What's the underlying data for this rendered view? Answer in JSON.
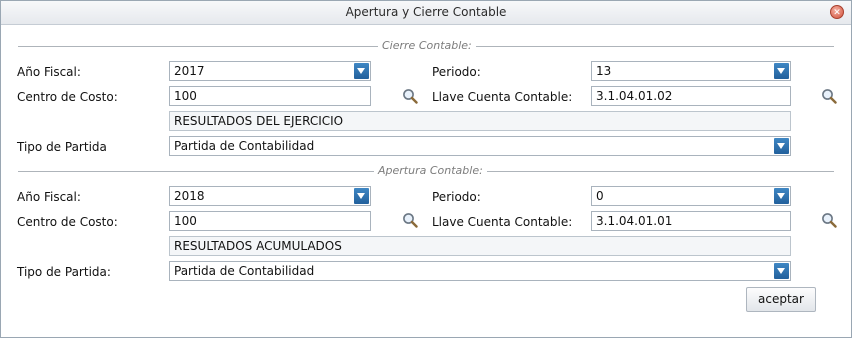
{
  "window": {
    "title": "Apertura y Cierre Contable",
    "close_icon": "close-icon"
  },
  "cierre": {
    "legend": "Cierre Contable:",
    "anio_label": "Año Fiscal:",
    "anio_value": "2017",
    "periodo_label": "Periodo:",
    "periodo_value": "13",
    "centro_label": "Centro de Costo:",
    "centro_value": "100",
    "llave_label": "Llave Cuenta Contable:",
    "llave_value": "3.1.04.01.02",
    "cuenta_desc": "RESULTADOS DEL EJERCICIO",
    "tipo_label": "Tipo de Partida",
    "tipo_value": "Partida de Contabilidad"
  },
  "apertura": {
    "legend": "Apertura Contable:",
    "anio_label": "Año Fiscal:",
    "anio_value": "2018",
    "periodo_label": "Periodo:",
    "periodo_value": "0",
    "centro_label": "Centro de Costo:",
    "centro_value": "100",
    "llave_label": "Llave Cuenta Contable:",
    "llave_value": "3.1.04.01.01",
    "cuenta_desc": "RESULTADOS ACUMULADOS",
    "tipo_label": "Tipo de Partida:",
    "tipo_value": "Partida de Contabilidad"
  },
  "actions": {
    "accept_label": "aceptar"
  },
  "colors": {
    "dropdown_arrow": "#2f74b5",
    "close_button": "#d2503a"
  }
}
